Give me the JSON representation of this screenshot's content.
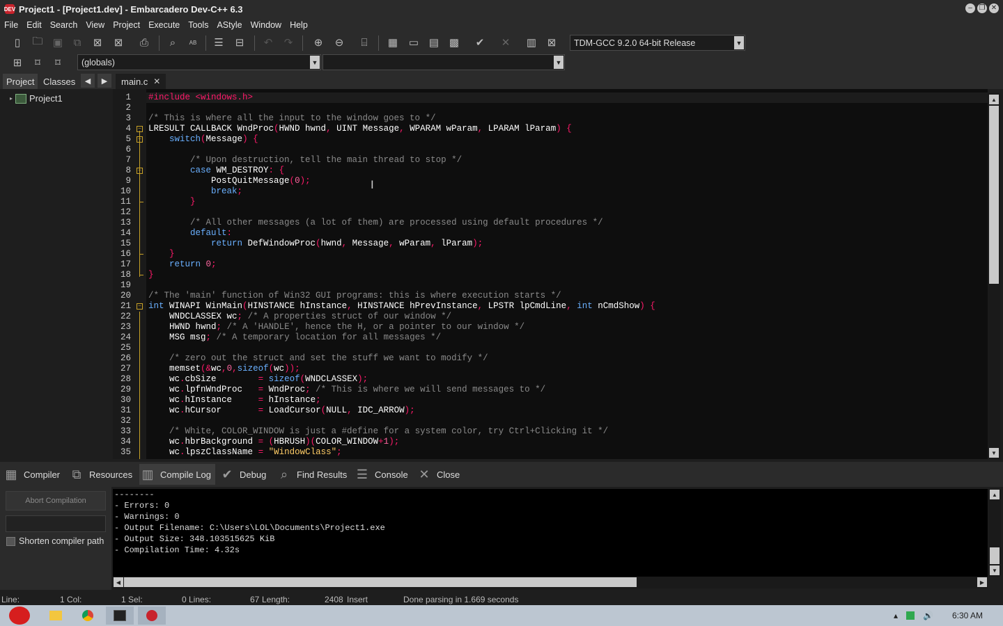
{
  "window": {
    "title": "Project1 - [Project1.dev] - Embarcadero Dev-C++ 6.3",
    "icon_label": "DEV"
  },
  "menu": [
    "File",
    "Edit",
    "Search",
    "View",
    "Project",
    "Execute",
    "Tools",
    "AStyle",
    "Window",
    "Help"
  ],
  "toolbar": {
    "compiler_select": "TDM-GCC 9.2.0 64-bit Release",
    "scope_select": "(globals)",
    "function_select": ""
  },
  "left_panel": {
    "tabs": [
      "Project",
      "Classes"
    ],
    "tree_root": "Project1"
  },
  "editor": {
    "tab_label": "main.c",
    "lines": [
      [
        [
          "pp",
          "#include <windows.h>"
        ]
      ],
      [],
      [
        [
          "cm",
          "/* This is where all the input to the window goes to */"
        ]
      ],
      [
        [
          "tx",
          "LRESULT CALLBACK WndProc"
        ],
        [
          "sy",
          "("
        ],
        [
          "tx",
          "HWND hwnd"
        ],
        [
          "sy",
          ","
        ],
        [
          "tx",
          " UINT Message"
        ],
        [
          "sy",
          ","
        ],
        [
          "tx",
          " WPARAM wParam"
        ],
        [
          "sy",
          ","
        ],
        [
          "tx",
          " LPARAM lParam"
        ],
        [
          "sy",
          ")"
        ],
        [
          "tx",
          " "
        ],
        [
          "sy",
          "{"
        ]
      ],
      [
        [
          "tx",
          "    "
        ],
        [
          "kw",
          "switch"
        ],
        [
          "sy",
          "("
        ],
        [
          "tx",
          "Message"
        ],
        [
          "sy",
          ")"
        ],
        [
          "tx",
          " "
        ],
        [
          "sy",
          "{"
        ]
      ],
      [],
      [
        [
          "tx",
          "        "
        ],
        [
          "cm",
          "/* Upon destruction, tell the main thread to stop */"
        ]
      ],
      [
        [
          "tx",
          "        "
        ],
        [
          "kw",
          "case"
        ],
        [
          "tx",
          " WM_DESTROY"
        ],
        [
          "sy",
          ":"
        ],
        [
          "tx",
          " "
        ],
        [
          "sy",
          "{"
        ]
      ],
      [
        [
          "tx",
          "            PostQuitMessage"
        ],
        [
          "sy",
          "("
        ],
        [
          "nu",
          "0"
        ],
        [
          "sy",
          ");"
        ]
      ],
      [
        [
          "tx",
          "            "
        ],
        [
          "kw",
          "break"
        ],
        [
          "sy",
          ";"
        ]
      ],
      [
        [
          "tx",
          "        "
        ],
        [
          "sy",
          "}"
        ]
      ],
      [],
      [
        [
          "tx",
          "        "
        ],
        [
          "cm",
          "/* All other messages (a lot of them) are processed using default procedures */"
        ]
      ],
      [
        [
          "tx",
          "        "
        ],
        [
          "kw",
          "default"
        ],
        [
          "sy",
          ":"
        ]
      ],
      [
        [
          "tx",
          "            "
        ],
        [
          "kw",
          "return"
        ],
        [
          "tx",
          " DefWindowProc"
        ],
        [
          "sy",
          "("
        ],
        [
          "tx",
          "hwnd"
        ],
        [
          "sy",
          ","
        ],
        [
          "tx",
          " Message"
        ],
        [
          "sy",
          ","
        ],
        [
          "tx",
          " wParam"
        ],
        [
          "sy",
          ","
        ],
        [
          "tx",
          " lParam"
        ],
        [
          "sy",
          ");"
        ]
      ],
      [
        [
          "tx",
          "    "
        ],
        [
          "sy",
          "}"
        ]
      ],
      [
        [
          "tx",
          "    "
        ],
        [
          "kw",
          "return"
        ],
        [
          "tx",
          " "
        ],
        [
          "nu",
          "0"
        ],
        [
          "sy",
          ";"
        ]
      ],
      [
        [
          "sy",
          "}"
        ]
      ],
      [],
      [
        [
          "cm",
          "/* The 'main' function of Win32 GUI programs: this is where execution starts */"
        ]
      ],
      [
        [
          "kw",
          "int"
        ],
        [
          "tx",
          " WINAPI WinMain"
        ],
        [
          "sy",
          "("
        ],
        [
          "tx",
          "HINSTANCE hInstance"
        ],
        [
          "sy",
          ","
        ],
        [
          "tx",
          " HINSTANCE hPrevInstance"
        ],
        [
          "sy",
          ","
        ],
        [
          "tx",
          " LPSTR lpCmdLine"
        ],
        [
          "sy",
          ","
        ],
        [
          "tx",
          " "
        ],
        [
          "kw",
          "int"
        ],
        [
          "tx",
          " nCmdShow"
        ],
        [
          "sy",
          ")"
        ],
        [
          "tx",
          " "
        ],
        [
          "sy",
          "{"
        ]
      ],
      [
        [
          "tx",
          "    WNDCLASSEX wc"
        ],
        [
          "sy",
          ";"
        ],
        [
          "tx",
          " "
        ],
        [
          "cm",
          "/* A properties struct of our window */"
        ]
      ],
      [
        [
          "tx",
          "    HWND hwnd"
        ],
        [
          "sy",
          ";"
        ],
        [
          "tx",
          " "
        ],
        [
          "cm",
          "/* A 'HANDLE', hence the H, or a pointer to our window */"
        ]
      ],
      [
        [
          "tx",
          "    MSG msg"
        ],
        [
          "sy",
          ";"
        ],
        [
          "tx",
          " "
        ],
        [
          "cm",
          "/* A temporary location for all messages */"
        ]
      ],
      [],
      [
        [
          "tx",
          "    "
        ],
        [
          "cm",
          "/* zero out the struct and set the stuff we want to modify */"
        ]
      ],
      [
        [
          "tx",
          "    memset"
        ],
        [
          "sy",
          "(&"
        ],
        [
          "tx",
          "wc"
        ],
        [
          "sy",
          ","
        ],
        [
          "nu",
          "0"
        ],
        [
          "sy",
          ","
        ],
        [
          "kw",
          "sizeof"
        ],
        [
          "sy",
          "("
        ],
        [
          "tx",
          "wc"
        ],
        [
          "sy",
          "));"
        ]
      ],
      [
        [
          "tx",
          "    wc"
        ],
        [
          "sy",
          "."
        ],
        [
          "tx",
          "cbSize        "
        ],
        [
          "sy",
          "="
        ],
        [
          "tx",
          " "
        ],
        [
          "kw",
          "sizeof"
        ],
        [
          "sy",
          "("
        ],
        [
          "tx",
          "WNDCLASSEX"
        ],
        [
          "sy",
          ");"
        ]
      ],
      [
        [
          "tx",
          "    wc"
        ],
        [
          "sy",
          "."
        ],
        [
          "tx",
          "lpfnWndProc   "
        ],
        [
          "sy",
          "="
        ],
        [
          "tx",
          " WndProc"
        ],
        [
          "sy",
          ";"
        ],
        [
          "tx",
          " "
        ],
        [
          "cm",
          "/* This is where we will send messages to */"
        ]
      ],
      [
        [
          "tx",
          "    wc"
        ],
        [
          "sy",
          "."
        ],
        [
          "tx",
          "hInstance     "
        ],
        [
          "sy",
          "="
        ],
        [
          "tx",
          " hInstance"
        ],
        [
          "sy",
          ";"
        ]
      ],
      [
        [
          "tx",
          "    wc"
        ],
        [
          "sy",
          "."
        ],
        [
          "tx",
          "hCursor       "
        ],
        [
          "sy",
          "="
        ],
        [
          "tx",
          " LoadCursor"
        ],
        [
          "sy",
          "("
        ],
        [
          "tx",
          "NULL"
        ],
        [
          "sy",
          ","
        ],
        [
          "tx",
          " IDC_ARROW"
        ],
        [
          "sy",
          ");"
        ]
      ],
      [],
      [
        [
          "tx",
          "    "
        ],
        [
          "cm",
          "/* White, COLOR_WINDOW is just a #define for a system color, try Ctrl+Clicking it */"
        ]
      ],
      [
        [
          "tx",
          "    wc"
        ],
        [
          "sy",
          "."
        ],
        [
          "tx",
          "hbrBackground "
        ],
        [
          "sy",
          "="
        ],
        [
          "tx",
          " "
        ],
        [
          "sy",
          "("
        ],
        [
          "tx",
          "HBRUSH"
        ],
        [
          "sy",
          ")("
        ],
        [
          "tx",
          "COLOR_WINDOW"
        ],
        [
          "sy",
          "+"
        ],
        [
          "nu",
          "1"
        ],
        [
          "sy",
          ");"
        ]
      ],
      [
        [
          "tx",
          "    wc"
        ],
        [
          "sy",
          "."
        ],
        [
          "tx",
          "lpszClassName "
        ],
        [
          "sy",
          "="
        ],
        [
          "tx",
          " "
        ],
        [
          "st",
          "\"WindowClass\""
        ],
        [
          "sy",
          ";"
        ]
      ]
    ]
  },
  "bottom_tabs": [
    "Compiler",
    "Resources",
    "Compile Log",
    "Debug",
    "Find Results",
    "Console",
    "Close"
  ],
  "compile_panel": {
    "abort_label": "Abort Compilation",
    "shorten_label": "Shorten compiler path",
    "log": [
      "--------",
      "- Errors: 0",
      "- Warnings: 0",
      "- Output Filename: C:\\Users\\LOL\\Documents\\Project1.exe",
      "- Output Size: 348.103515625 KiB",
      "- Compilation Time: 4.32s"
    ]
  },
  "status": {
    "line_label": "Line:",
    "line_val": "1",
    "col_label": "Col:",
    "col_val": "1",
    "sel_label": "Sel:",
    "sel_val": "0",
    "lines_label": "Lines:",
    "lines_val": "67",
    "length_label": "Length:",
    "length_val": "2408",
    "mode": "Insert",
    "message": "Done parsing in 1.669 seconds"
  },
  "taskbar": {
    "clock": "6:30 AM"
  },
  "colors": {
    "preprocessor": "#ff1a6a",
    "comment": "#8a8a8a",
    "keyword": "#6ab0ff",
    "symbol": "#ff1a6a",
    "number": "#ff66a0",
    "string": "#ffcc66"
  }
}
